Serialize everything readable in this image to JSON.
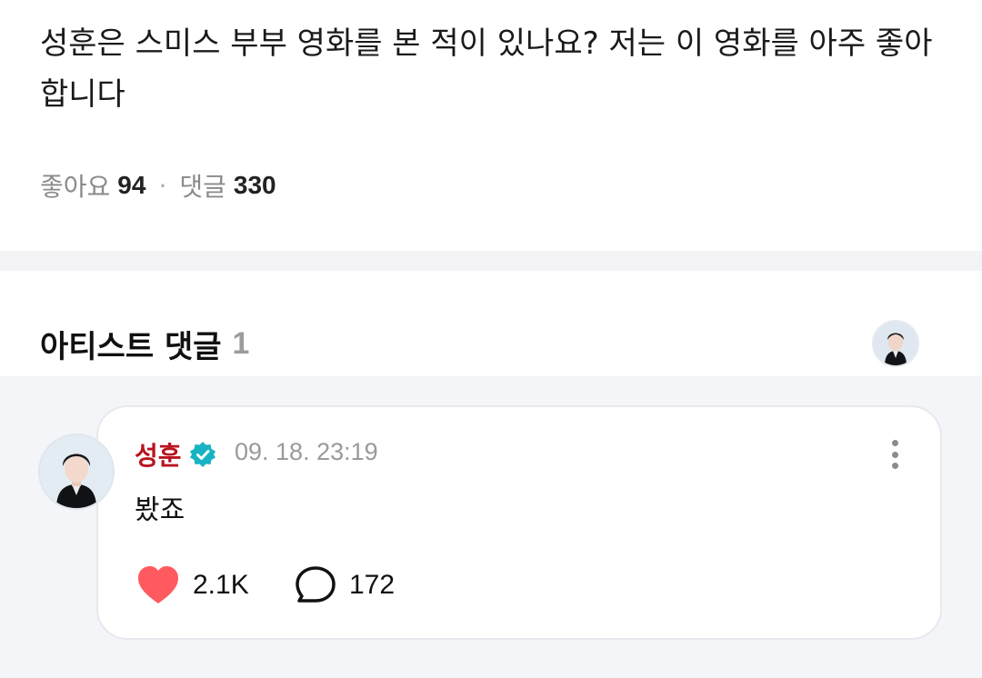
{
  "post": {
    "text": "성훈은 스미스 부부 영화를 본 적이 있나요?  저는 이 영화를 아주 좋아합니다",
    "likes_label": "좋아요",
    "likes_count": "94",
    "separator": "·",
    "comments_label": "댓글",
    "comments_count": "330"
  },
  "artist_comments": {
    "title": "아티스트 댓글",
    "count": "1"
  },
  "comment": {
    "author": "성훈",
    "verified_icon": "verified-badge-icon",
    "timestamp": "09. 18. 23:19",
    "text": "봤죠",
    "like_count": "2.1K",
    "reply_count": "172",
    "colors": {
      "author": "#b8141f",
      "badge": "#17b3c4",
      "heart": "#ff5a5f"
    }
  }
}
